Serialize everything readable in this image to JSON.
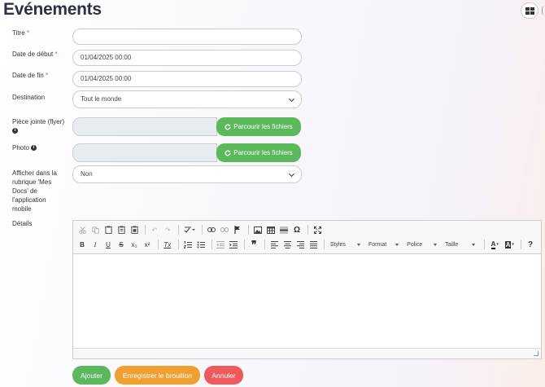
{
  "page": {
    "title": "Evénements"
  },
  "top_icons": [
    "grid-icon",
    "edge-icon"
  ],
  "form": {
    "titre": {
      "label": "Titre",
      "required": "*",
      "value": ""
    },
    "date_debut": {
      "label": "Date de début",
      "required": "*",
      "value": "01/04/2025 00:00"
    },
    "date_fin": {
      "label": "Date de fin",
      "required": "*",
      "value": "01/04/2025 00:00"
    },
    "destination": {
      "label": "Destination",
      "value": "Tout le monde"
    },
    "piece_jointe": {
      "label_line1": "Pièce jointe (flyer)",
      "info_glyph": "i",
      "button": "Parcourir les fichiers"
    },
    "photo": {
      "label": "Photo",
      "info_glyph": "i",
      "button": "Parcourir les fichiers"
    },
    "mes_docs": {
      "label_lines": [
        "Afficher dans la",
        "rubrique 'Mes",
        "Docs' de",
        "l'application",
        "mobile"
      ],
      "value": "Non"
    },
    "details": {
      "label": "Détails"
    }
  },
  "editor": {
    "toolbar_row1": [
      "cut-icon",
      "copy-icon",
      "paste-icon",
      "paste-text-icon",
      "paste-word-icon",
      "undo-icon",
      "redo-icon",
      "spellcheck-icon",
      "link-icon",
      "unlink-icon",
      "anchor-icon",
      "image-icon",
      "table-icon",
      "horizontal-rule-icon",
      "special-char-icon",
      "maximize-icon"
    ],
    "toolbar_row2": {
      "format_buttons": [
        "B",
        "I",
        "U",
        "S",
        "x₂",
        "x²",
        "Tx"
      ],
      "combos": [
        "Styles",
        "Format",
        "Police",
        "Taille"
      ],
      "help": "?"
    }
  },
  "actions": {
    "add": {
      "label": "Ajouter",
      "color": "#5cb85c"
    },
    "draft": {
      "label": "Enregistrer le brouillon",
      "color": "#f0a030"
    },
    "cancel": {
      "label": "Annuler",
      "color": "#f05a5a"
    }
  }
}
